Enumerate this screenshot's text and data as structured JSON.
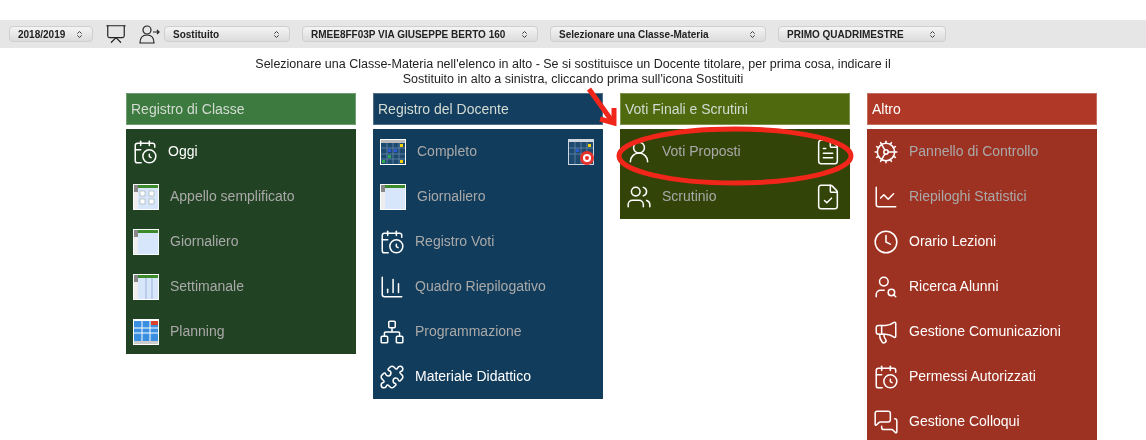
{
  "toolbar": {
    "selects": [
      {
        "value": "2018/2019"
      },
      {
        "value": "Sostituito"
      },
      {
        "value": "RMEE8FF03P VIA GIUSEPPE BERTO 160"
      },
      {
        "value": "Selezionare una Classe-Materia"
      },
      {
        "value": "PRIMO QUADRIMESTRE"
      }
    ]
  },
  "notice": "Selezionare una Classe-Materia nell'elenco in alto - Se si sostituisce un Docente titolare, per prima cosa, indicare il Sostituito in alto a sinistra, cliccando prima sull'icona Sostituiti",
  "panels": [
    {
      "title": "Registro di Classe",
      "color": "#3d7a3f",
      "items": [
        {
          "label": "Oggi",
          "dimmed": false
        },
        {
          "label": "Appello semplificato",
          "dimmed": true
        },
        {
          "label": "Giornaliero",
          "dimmed": true
        },
        {
          "label": "Settimanale",
          "dimmed": true
        },
        {
          "label": "Planning",
          "dimmed": true
        }
      ]
    },
    {
      "title": "Registro del Docente",
      "color": "#133e5f",
      "items": [
        {
          "label": "Completo",
          "dimmed": true
        },
        {
          "label": "Giornaliero",
          "dimmed": true
        },
        {
          "label": "Registro Voti",
          "dimmed": true
        },
        {
          "label": "Quadro Riepilogativo",
          "dimmed": true
        },
        {
          "label": "Programmazione",
          "dimmed": true
        },
        {
          "label": "Materiale Didattico",
          "dimmed": false
        }
      ]
    },
    {
      "title": "Voti Finali e Scrutini",
      "color": "#4f6a0e",
      "items": [
        {
          "label": "Voti Proposti",
          "dimmed": true
        },
        {
          "label": "Scrutinio",
          "dimmed": true
        }
      ]
    },
    {
      "title": "Altro",
      "color": "#b03826",
      "items": [
        {
          "label": "Pannello di Controllo",
          "dimmed": true
        },
        {
          "label": "Riepiloghi Statistici",
          "dimmed": true
        },
        {
          "label": "Orario Lezioni",
          "dimmed": false
        },
        {
          "label": "Ricerca Alunni",
          "dimmed": false
        },
        {
          "label": "Gestione Comunicazioni",
          "dimmed": false
        },
        {
          "label": "Permessi Autorizzati",
          "dimmed": false
        },
        {
          "label": "Gestione Colloqui",
          "dimmed": false
        }
      ]
    }
  ]
}
